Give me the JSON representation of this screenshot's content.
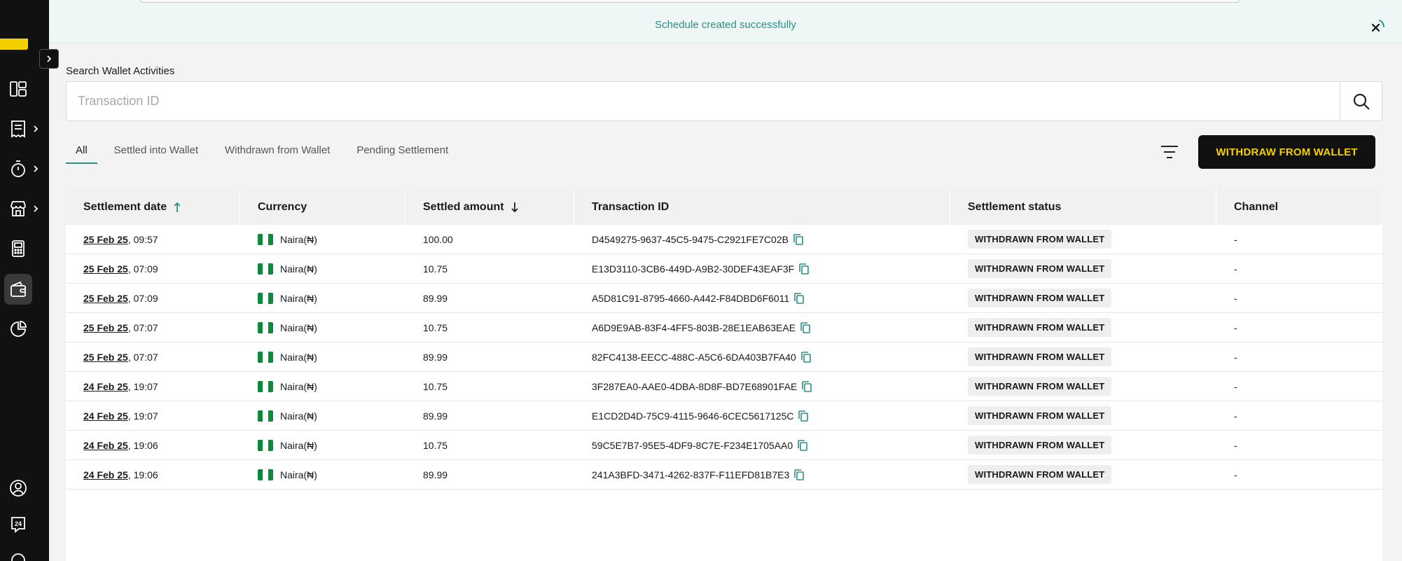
{
  "toast": {
    "message": "Schedule created successfully"
  },
  "search": {
    "label": "Search Wallet Activities",
    "placeholder": "Transaction ID"
  },
  "tabs": [
    {
      "label": "All",
      "active": true
    },
    {
      "label": "Settled into Wallet"
    },
    {
      "label": "Withdrawn from Wallet"
    },
    {
      "label": "Pending Settlement"
    }
  ],
  "actions": {
    "withdraw_label": "WITHDRAW FROM WALLET"
  },
  "table": {
    "headers": [
      "Settlement date",
      "Currency",
      "Settled amount",
      "Transaction ID",
      "Settlement status",
      "Channel"
    ],
    "rows": [
      {
        "date": "25 Feb 25",
        "time": ", 09:57",
        "currency": "Naira(₦)",
        "amount": "100.00",
        "txid": "D4549275-9637-45C5-9475-C2921FE7C02B",
        "status": "WITHDRAWN FROM WALLET",
        "channel": "-"
      },
      {
        "date": "25 Feb 25",
        "time": ", 07:09",
        "currency": "Naira(₦)",
        "amount": "10.75",
        "txid": "E13D3110-3CB6-449D-A9B2-30DEF43EAF3F",
        "status": "WITHDRAWN FROM WALLET",
        "channel": "-"
      },
      {
        "date": "25 Feb 25",
        "time": ", 07:09",
        "currency": "Naira(₦)",
        "amount": "89.99",
        "txid": "A5D81C91-8795-4660-A442-F84DBD6F6011",
        "status": "WITHDRAWN FROM WALLET",
        "channel": "-"
      },
      {
        "date": "25 Feb 25",
        "time": ", 07:07",
        "currency": "Naira(₦)",
        "amount": "10.75",
        "txid": "A6D9E9AB-83F4-4FF5-803B-28E1EAB63EAE",
        "status": "WITHDRAWN FROM WALLET",
        "channel": "-"
      },
      {
        "date": "25 Feb 25",
        "time": ", 07:07",
        "currency": "Naira(₦)",
        "amount": "89.99",
        "txid": "82FC4138-EECC-488C-A5C6-6DA403B7FA40",
        "status": "WITHDRAWN FROM WALLET",
        "channel": "-"
      },
      {
        "date": "24 Feb 25",
        "time": ", 19:07",
        "currency": "Naira(₦)",
        "amount": "10.75",
        "txid": "3F287EA0-AAE0-4DBA-8D8F-BD7E68901FAE",
        "status": "WITHDRAWN FROM WALLET",
        "channel": "-"
      },
      {
        "date": "24 Feb 25",
        "time": ", 19:07",
        "currency": "Naira(₦)",
        "amount": "89.99",
        "txid": "E1CD2D4D-75C9-4115-9646-6CEC5617125C",
        "status": "WITHDRAWN FROM WALLET",
        "channel": "-"
      },
      {
        "date": "24 Feb 25",
        "time": ", 19:06",
        "currency": "Naira(₦)",
        "amount": "10.75",
        "txid": "59C5E7B7-95E5-4DF9-8C7E-F234E1705AA0",
        "status": "WITHDRAWN FROM WALLET",
        "channel": "-"
      },
      {
        "date": "24 Feb 25",
        "time": ", 19:06",
        "currency": "Naira(₦)",
        "amount": "89.99",
        "txid": "241A3BFD-3471-4262-837F-F11EFD81B7E3",
        "status": "WITHDRAWN FROM WALLET",
        "channel": "-"
      }
    ]
  },
  "sidebar": {
    "bottom_badge": "24"
  },
  "colors": {
    "accent": "#2b8f84",
    "brand_yellow": "#f5d000",
    "sidebar_bg": "#111111"
  }
}
